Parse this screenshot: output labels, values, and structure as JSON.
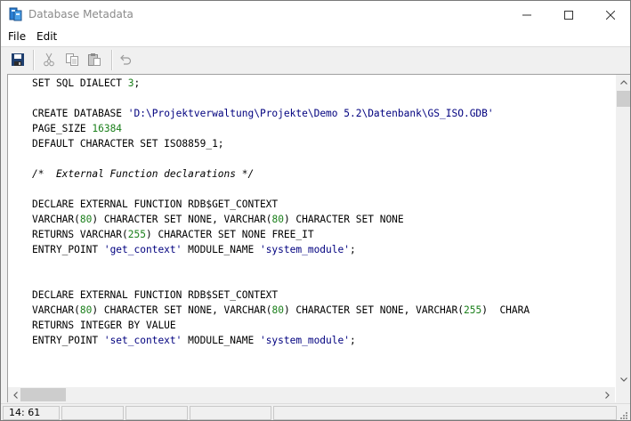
{
  "window": {
    "title": "Database Metadata"
  },
  "menubar": {
    "items": [
      "File",
      "Edit"
    ]
  },
  "toolbar": {
    "icons": [
      "save-icon",
      "cut-icon",
      "copy-icon",
      "paste-icon",
      "undo-icon"
    ]
  },
  "editor": {
    "lines": [
      [
        {
          "t": "SET SQL DIALECT ",
          "c": "kw"
        },
        {
          "t": "3",
          "c": "num"
        },
        {
          "t": ";",
          "c": "kw"
        }
      ],
      [],
      [
        {
          "t": "CREATE DATABASE ",
          "c": "kw"
        },
        {
          "t": "'D:\\Projektverwaltung\\Projekte\\Demo 5.2\\Datenbank\\GS_ISO.GDB'",
          "c": "str"
        }
      ],
      [
        {
          "t": "PAGE_SIZE ",
          "c": "kw"
        },
        {
          "t": "16384",
          "c": "num"
        }
      ],
      [
        {
          "t": "DEFAULT CHARACTER SET ISO8859_1;",
          "c": "kw"
        }
      ],
      [],
      [
        {
          "t": "/*  External Function declarations */",
          "c": "comment"
        }
      ],
      [],
      [
        {
          "t": "DECLARE EXTERNAL FUNCTION RDB$GET_CONTEXT",
          "c": "kw"
        }
      ],
      [
        {
          "t": "VARCHAR(",
          "c": "kw"
        },
        {
          "t": "80",
          "c": "num"
        },
        {
          "t": ") CHARACTER SET NONE, VARCHAR(",
          "c": "kw"
        },
        {
          "t": "80",
          "c": "num"
        },
        {
          "t": ") CHARACTER SET NONE",
          "c": "kw"
        }
      ],
      [
        {
          "t": "RETURNS VARCHAR(",
          "c": "kw"
        },
        {
          "t": "255",
          "c": "num"
        },
        {
          "t": ") CHARACTER SET NONE FREE_IT",
          "c": "kw"
        }
      ],
      [
        {
          "t": "ENTRY_POINT ",
          "c": "kw"
        },
        {
          "t": "'get_context'",
          "c": "str"
        },
        {
          "t": " MODULE_NAME ",
          "c": "kw"
        },
        {
          "t": "'system_module'",
          "c": "str"
        },
        {
          "t": ";",
          "c": "kw"
        }
      ],
      [],
      [],
      [
        {
          "t": "DECLARE EXTERNAL FUNCTION RDB$SET_CONTEXT",
          "c": "kw"
        }
      ],
      [
        {
          "t": "VARCHAR(",
          "c": "kw"
        },
        {
          "t": "80",
          "c": "num"
        },
        {
          "t": ") CHARACTER SET NONE, VARCHAR(",
          "c": "kw"
        },
        {
          "t": "80",
          "c": "num"
        },
        {
          "t": ") CHARACTER SET NONE, VARCHAR(",
          "c": "kw"
        },
        {
          "t": "255",
          "c": "num"
        },
        {
          "t": ")  CHARA",
          "c": "kw"
        }
      ],
      [
        {
          "t": "RETURNS INTEGER BY VALUE",
          "c": "kw"
        }
      ],
      [
        {
          "t": "ENTRY_POINT ",
          "c": "kw"
        },
        {
          "t": "'set_context'",
          "c": "str"
        },
        {
          "t": " MODULE_NAME ",
          "c": "kw"
        },
        {
          "t": "'system_module'",
          "c": "str"
        },
        {
          "t": ";",
          "c": "kw"
        }
      ]
    ]
  },
  "statusbar": {
    "position": "14: 61",
    "panels": [
      "",
      "",
      "",
      ""
    ]
  },
  "colors": {
    "number": "#1a7f1a",
    "string": "#00007f",
    "text": "#000000"
  }
}
